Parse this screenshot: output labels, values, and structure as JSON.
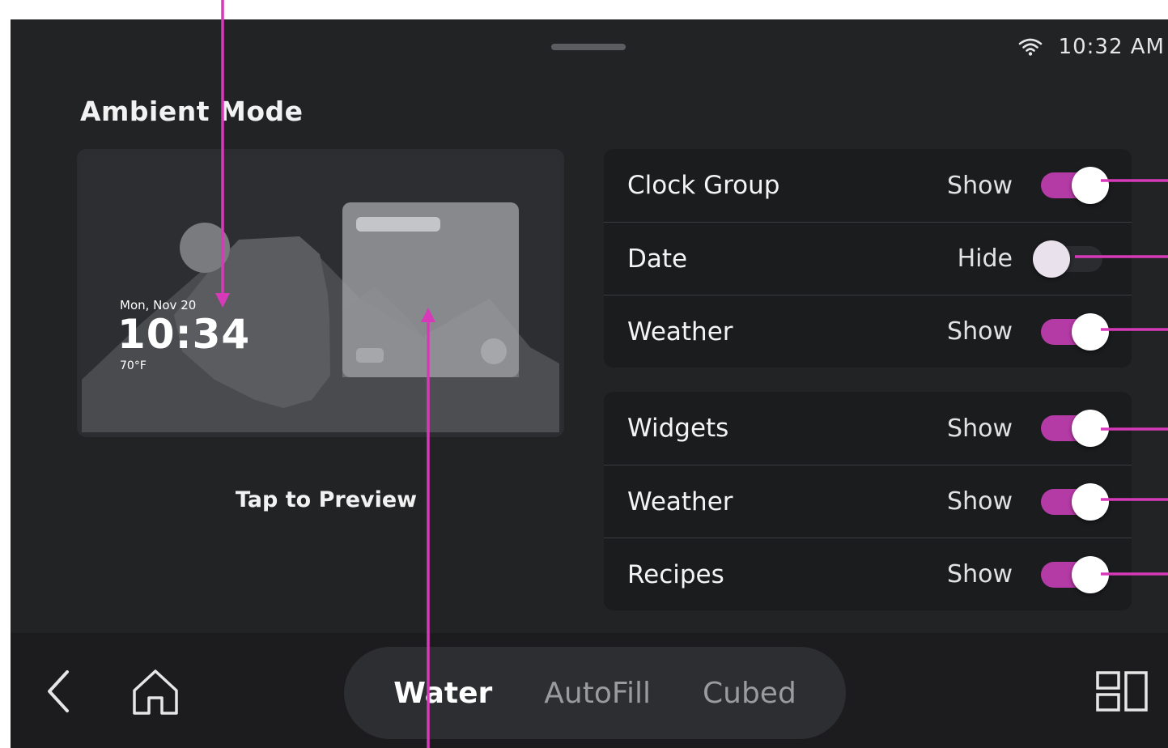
{
  "status": {
    "time": "10:32 AM",
    "wifi_icon": "wifi-icon"
  },
  "page": {
    "title": "Ambient Mode"
  },
  "preview": {
    "date": "Mon, Nov 20",
    "time": "10:34",
    "temperature": "70°F",
    "tap_label": "Tap to Preview"
  },
  "settings": {
    "group1": [
      {
        "label": "Clock Group",
        "state": "Show",
        "on": true
      },
      {
        "label": "Date",
        "state": "Hide",
        "on": false
      },
      {
        "label": "Weather",
        "state": "Show",
        "on": true
      }
    ],
    "group2": [
      {
        "label": "Widgets",
        "state": "Show",
        "on": true
      },
      {
        "label": "Weather",
        "state": "Show",
        "on": true
      },
      {
        "label": "Recipes",
        "state": "Show",
        "on": true
      }
    ]
  },
  "navbar": {
    "back_icon": "back-icon",
    "home_icon": "home-icon",
    "options": [
      "Water",
      "AutoFill",
      "Cubed"
    ],
    "selected": "Water",
    "layout_icon": "layout-icon"
  },
  "colors": {
    "accent": "#b43aa5",
    "annotation": "#d63ab8",
    "screen_bg": "#222325"
  }
}
